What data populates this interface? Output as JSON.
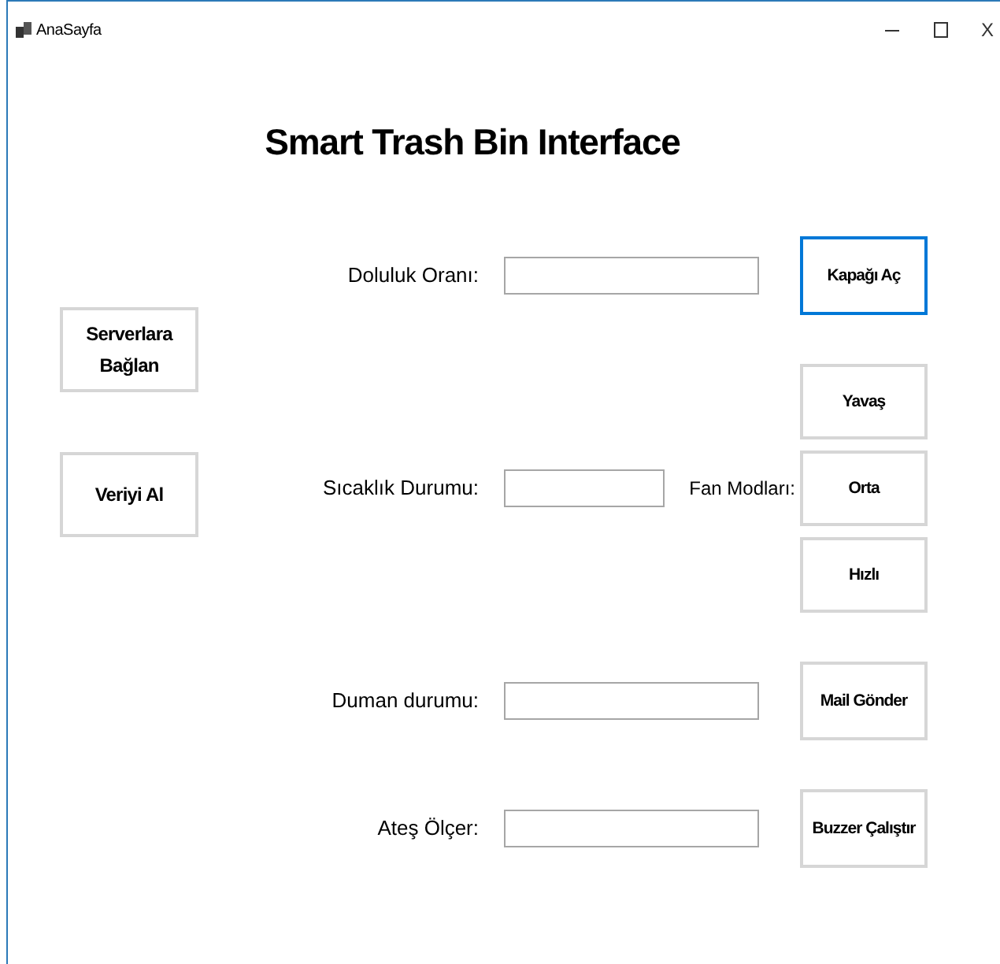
{
  "window": {
    "title": "AnaSayfa",
    "close_label": "X"
  },
  "heading": "Smart Trash Bin Interface",
  "left_buttons": [
    {
      "label": "Serverlara Bağlan",
      "focused": false
    },
    {
      "label": "Veriyi Al",
      "focused": false
    }
  ],
  "rows": [
    {
      "kind": "field",
      "label": "Doluluk Oranı:",
      "buttons": [
        {
          "label": "Kapağı Aç",
          "focused": true
        }
      ]
    },
    {
      "kind": "fan",
      "label": "Sıcaklık Durumu:",
      "group_label": "Fan Modları:",
      "buttons": [
        {
          "label": "Yavaş",
          "focused": false
        },
        {
          "label": "Orta",
          "focused": false
        },
        {
          "label": "Hızlı",
          "focused": false
        }
      ]
    },
    {
      "kind": "field",
      "label": "Duman durumu:",
      "buttons": [
        {
          "label": "Mail Gönder",
          "focused": false
        }
      ]
    },
    {
      "kind": "field",
      "label": "Ateş Ölçer:",
      "buttons": [
        {
          "label": "Buzzer Çalıştır",
          "focused": false
        }
      ]
    }
  ]
}
